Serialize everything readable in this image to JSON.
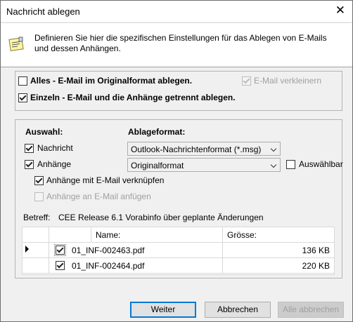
{
  "window": {
    "title": "Nachricht ablegen"
  },
  "header": {
    "description": "Definieren Sie hier die spezifischen Einstellungen für das Ablegen von E-Mails und dessen Anhängen."
  },
  "mode": {
    "alles_label": "Alles - E-Mail im Originalformat ablegen.",
    "alles_checked": false,
    "verkleinern_label": "E-Mail verkleinern",
    "einzeln_label": "Einzeln - E-Mail und die Anhänge getrennt ablegen.",
    "einzeln_checked": true
  },
  "selection": {
    "auswahl_heading": "Auswahl:",
    "ablageformat_heading": "Ablageformat:",
    "nachricht_label": "Nachricht",
    "nachricht_format": "Outlook-Nachrichtenformat (*.msg)",
    "anhaenge_label": "Anhänge",
    "anhaenge_format": "Originalformat",
    "auswaehlbar_label": "Auswählbar",
    "verknuepfen_label": "Anhänge mit E-Mail verknüpfen",
    "anfuegen_label": "Anhänge an E-Mail anfügen"
  },
  "betreff": {
    "label": "Betreff:",
    "value": "CEE Release 6.1 Vorabinfo über geplante Änderungen"
  },
  "table": {
    "col_name": "Name:",
    "col_size": "Grösse:",
    "rows": [
      {
        "name": "01_INF-002463.pdf",
        "size": "136 KB",
        "checked": true,
        "current": true
      },
      {
        "name": "01_INF-002464.pdf",
        "size": "220 KB",
        "checked": true,
        "current": false
      }
    ]
  },
  "buttons": {
    "weiter": "Weiter",
    "abbrechen": "Abbrechen",
    "alle_abbrechen": "Alle abbrechen"
  }
}
